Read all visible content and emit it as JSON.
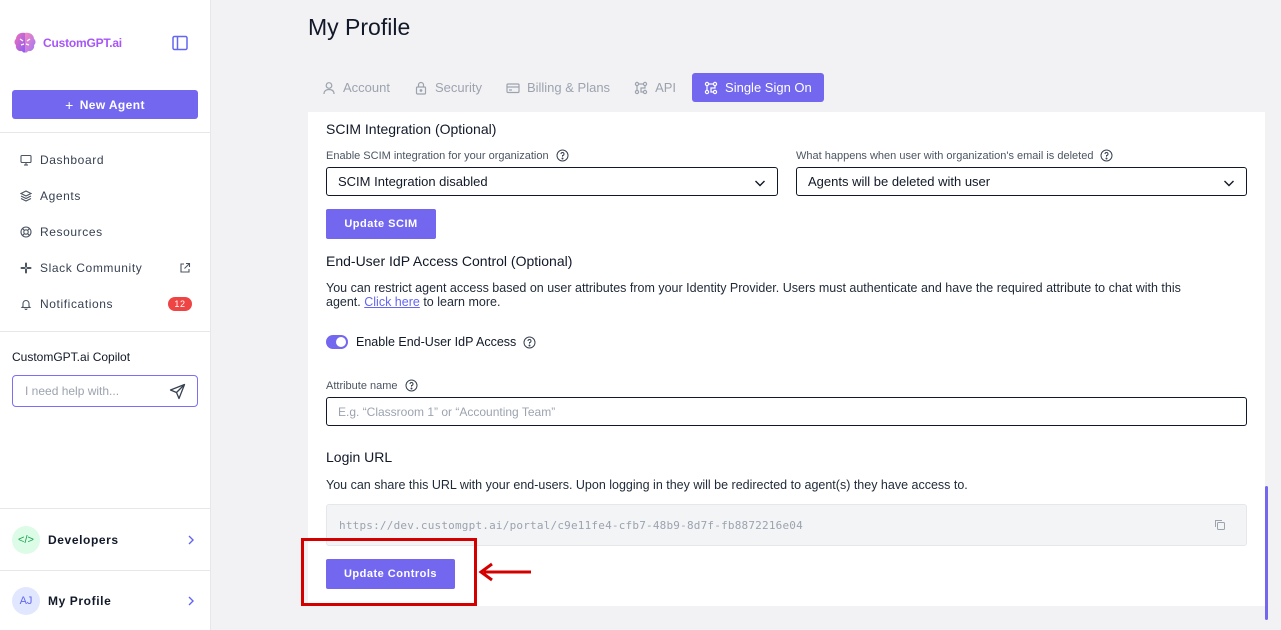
{
  "brand": {
    "name": "CustomGPT.ai"
  },
  "sidebar": {
    "new_agent_label": "New Agent",
    "items": [
      {
        "label": "Dashboard",
        "icon": "dashboard-icon"
      },
      {
        "label": "Agents",
        "icon": "layers-icon"
      },
      {
        "label": "Resources",
        "icon": "lifebuoy-icon"
      },
      {
        "label": "Slack Community",
        "icon": "slack-icon"
      },
      {
        "label": "Notifications",
        "icon": "bell-icon",
        "badge": "12"
      }
    ],
    "copilot": {
      "title": "CustomGPT.ai Copilot",
      "placeholder": "I need help with..."
    },
    "developers": {
      "label": "Developers",
      "avatar": "</>"
    },
    "profile": {
      "label": "My Profile",
      "initials": "AJ"
    }
  },
  "page": {
    "title": "My Profile"
  },
  "tabs": [
    {
      "label": "Account",
      "icon": "user-icon",
      "active": false
    },
    {
      "label": "Security",
      "icon": "lock-icon",
      "active": false
    },
    {
      "label": "Billing & Plans",
      "icon": "credit-card-icon",
      "active": false
    },
    {
      "label": "API",
      "icon": "api-icon",
      "active": false
    },
    {
      "label": "Single Sign On",
      "icon": "sso-icon",
      "active": true
    }
  ],
  "scim": {
    "title": "SCIM Integration (Optional)",
    "enable_label": "Enable SCIM integration for your organization",
    "enable_value": "SCIM Integration disabled",
    "delete_label": "What happens when user with organization's email is deleted",
    "delete_value": "Agents will be deleted with user",
    "update_button": "Update SCIM"
  },
  "idp": {
    "title": "End-User IdP Access Control (Optional)",
    "description_1": "You can restrict agent access based on user attributes from your Identity Provider. Users must authenticate and have the required attribute to chat with this",
    "description_2": "agent.",
    "link_text": "Click here",
    "description_3": "to learn more.",
    "toggle_label": "Enable End-User IdP Access",
    "toggle_on": true,
    "attribute_label": "Attribute name",
    "attribute_placeholder": "E.g. “Classroom 1” or “Accounting Team”"
  },
  "login": {
    "title": "Login URL",
    "description": "You can share this URL with your end-users. Upon logging in they will be redirected to agent(s) they have access to.",
    "url": "https://dev.customgpt.ai/portal/c9e11fe4-cfb7-48b9-8d7f-fb8872216e04"
  },
  "update_controls_label": "Update Controls",
  "colors": {
    "accent": "#7367f0",
    "highlight": "#d40000",
    "badge": "#ef4444"
  }
}
